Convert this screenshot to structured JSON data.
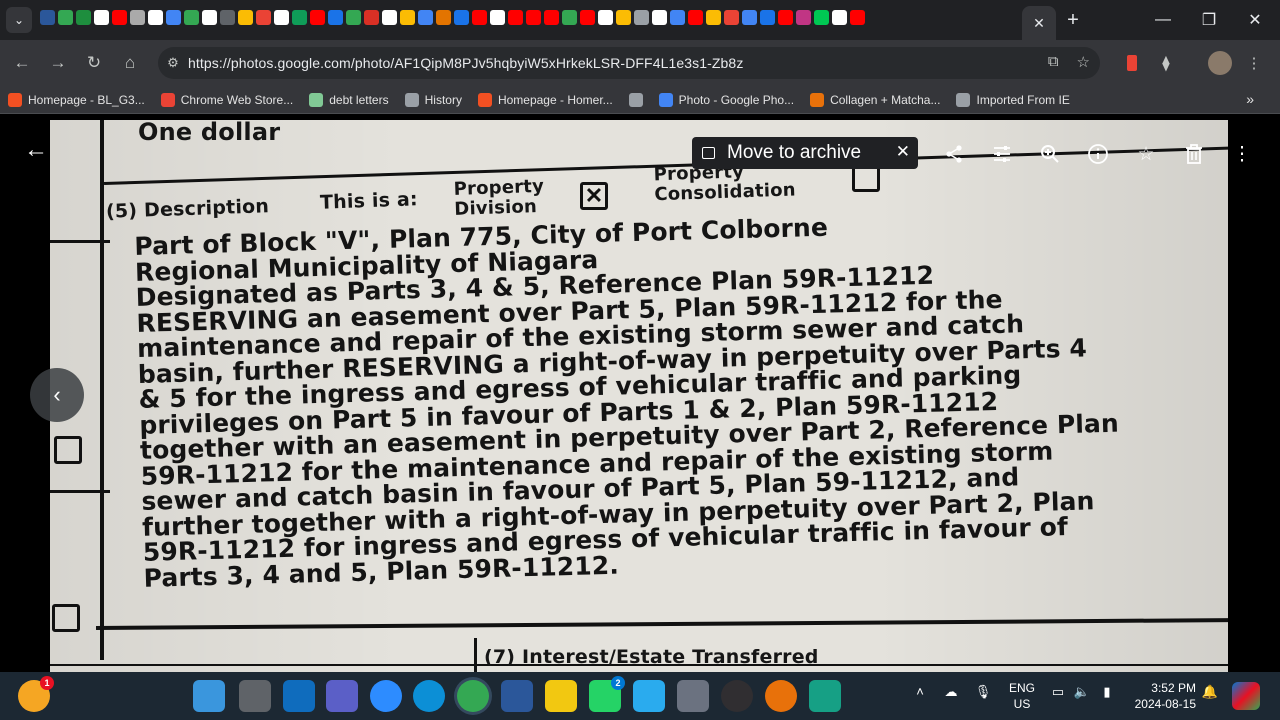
{
  "browser": {
    "active_tab_close": "✕",
    "new_tab": "+",
    "favicon_colors": [
      "#2b579a",
      "#34a853",
      "#1e8e3e",
      "#ffffff",
      "#ff0000",
      "#aaaaaa",
      "#ffffff",
      "#4285f4",
      "#34a853",
      "#ffffff",
      "#5f6368",
      "#fbbc04",
      "#ea4335",
      "#ffffff",
      "#0f9d58",
      "#ff0000",
      "#1a73e8",
      "#34a853",
      "#d93025",
      "#ffffff",
      "#fbbc04",
      "#4285f4",
      "#e37400",
      "#1a73e8",
      "#ff0000",
      "#ffffff",
      "#ff0000",
      "#ff0000",
      "#ff0000",
      "#34a853",
      "#ff0000",
      "#ffffff",
      "#fbbc04",
      "#9aa0a6",
      "#ffffff",
      "#4285f4",
      "#ff0000",
      "#fbbc04",
      "#ea4335",
      "#4285f4",
      "#1a73e8",
      "#ff0000",
      "#c13584",
      "#00c853",
      "#ffffff",
      "#ff0000"
    ],
    "url_host": "https://photos.google.com",
    "url_path": "/photo/AF1QipM8PJv5hqbyiW5xHrkekLSR-DFF4L1e3s1-Zb8z",
    "window_controls": {
      "minimize": "—",
      "restore": "❐",
      "close": "✕"
    }
  },
  "bookmarks": [
    {
      "label": "Homepage - BL_G3...",
      "color": "#f25022"
    },
    {
      "label": "Chrome Web Store...",
      "color": "#ea4335"
    },
    {
      "label": "debt letters",
      "color": "#81c995"
    },
    {
      "label": "History",
      "color": "#9aa0a6"
    },
    {
      "label": "Homepage - Homer...",
      "color": "#f25022"
    },
    {
      "label": "",
      "color": "#9aa0a6"
    },
    {
      "label": "Photo - Google Pho...",
      "color": "#4285f4"
    },
    {
      "label": "Collagen + Matcha...",
      "color": "#e8710a"
    },
    {
      "label": "Imported From IE",
      "color": "#9aa0a6"
    }
  ],
  "bookmarks_more": "»",
  "photo_viewer": {
    "back": "←",
    "prev": "‹",
    "archive_label": "Move to archive",
    "archive_close": "✕",
    "tools": [
      "share-icon",
      "edit-icon",
      "zoom-icon",
      "info-icon",
      "favorite-icon",
      "delete-icon",
      "more-icon"
    ]
  },
  "document": {
    "top_text": "One dollar",
    "section_label": "(5) Description",
    "this_is_a": "This is a:",
    "option_1": "Property Division",
    "option_2": "Property Consolidation",
    "checked_mark": "✕",
    "body_lines": [
      "Part of Block \"V\", Plan 775, City of Port Colborne",
      "Regional Municipality of Niagara",
      "Designated as Parts 3, 4 & 5, Reference Plan 59R-11212",
      "RESERVING an easement over Part 5, Plan 59R-11212 for the",
      "maintenance and repair of the existing storm sewer and catch",
      "basin, further RESERVING a right-of-way in perpetuity over Parts 4",
      "& 5 for the ingress and egress of vehicular traffic and parking",
      "privileges on Part 5 in favour of Parts 1 & 2, Plan 59R-11212",
      "together with an easement in perpetuity over Part 2, Reference Plan",
      "59R-11212 for the maintenance and repair of the existing storm",
      "sewer and catch basin in favour of Part 5, Plan 59-11212, and",
      "further together with a right-of-way in perpetuity over Part 2, Plan",
      "59R-11212 for ingress and egress of vehicular traffic in favour of",
      "Parts 3, 4 and 5, Plan 59R-11212."
    ],
    "next_section": "(7) Interest/Estate Transferred"
  },
  "taskbar": {
    "weather_badge": "1",
    "apps": [
      {
        "name": "start",
        "color": "#3a96dd"
      },
      {
        "name": "task-view",
        "color": "#5f6368"
      },
      {
        "name": "onedrive",
        "color": "#0f6cbd"
      },
      {
        "name": "teams",
        "color": "#5b5fc7"
      },
      {
        "name": "zoom",
        "color": "#2d8cff"
      },
      {
        "name": "edge",
        "color": "#0c8fd6"
      },
      {
        "name": "chrome",
        "color": "#34a853"
      },
      {
        "name": "word",
        "color": "#2b579a"
      },
      {
        "name": "file-explorer",
        "color": "#f2c811"
      },
      {
        "name": "whatsapp",
        "color": "#25d366"
      },
      {
        "name": "telegram",
        "color": "#2aabee"
      },
      {
        "name": "device",
        "color": "#6b7280"
      },
      {
        "name": "obs",
        "color": "#302e31"
      },
      {
        "name": "app-red",
        "color": "#e8710a"
      },
      {
        "name": "app-teal",
        "color": "#16a085"
      }
    ],
    "whatsapp_badge": "2",
    "lang_1": "ENG",
    "lang_2": "US",
    "time": "3:52 PM",
    "date": "2024-08-15"
  }
}
